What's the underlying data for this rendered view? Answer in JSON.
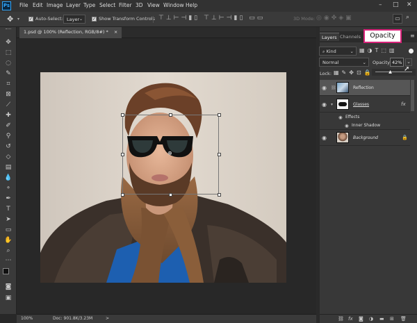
{
  "app": {
    "logo": "Ps"
  },
  "menubar": {
    "items": [
      "File",
      "Edit",
      "Image",
      "Layer",
      "Type",
      "Select",
      "Filter",
      "3D",
      "View",
      "Window",
      "Help"
    ],
    "minimize": "–",
    "restore": "□",
    "close": "✕"
  },
  "options": {
    "auto_select_label": "Auto-Select:",
    "auto_select_value": "Layer",
    "show_transform_label": "Show Transform Controls",
    "mode_3d": "3D Mode:"
  },
  "document": {
    "tab_title": "1.psd @ 100% (Reflection, RGB/8#) *",
    "close": "×"
  },
  "status": {
    "zoom": "100%",
    "doc": "Doc: 901.8K/3.23M",
    "arrow": ">"
  },
  "layers_panel": {
    "tabs": [
      "Layers",
      "Channels"
    ],
    "filter_kind": "Kind",
    "blend_mode": "Normal",
    "opacity_label": "Opacity:",
    "opacity_value": "42%",
    "opacity_level": 0.42,
    "lock_label": "Lock:",
    "layers": [
      {
        "name": "Reflection",
        "selected": true
      },
      {
        "name": "Glasses",
        "fx": "fx"
      },
      {
        "name": "Effects"
      },
      {
        "name": "Inner Shadow"
      },
      {
        "name": "Background",
        "locked": true
      }
    ]
  },
  "callout": {
    "text": "Opacity"
  },
  "colors": {
    "accent": "#31a8ff",
    "callout_border": "#d9237a",
    "selected_row": "#565656"
  }
}
